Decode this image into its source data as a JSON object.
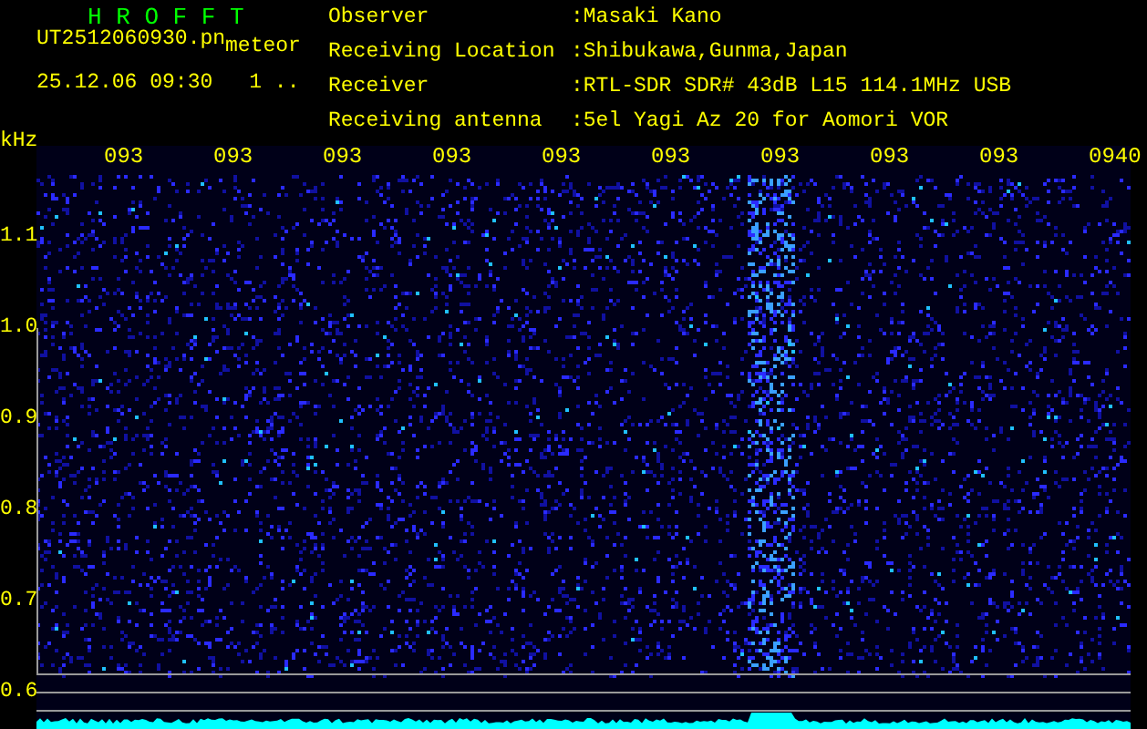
{
  "app_title": "H R O F F T",
  "file_name": "UT2512060930.pn",
  "mode": "meteor",
  "date_time": "25.12.06 09:30",
  "counter": "1 ..",
  "info": [
    {
      "label": "Observer",
      "value": ":Masaki Kano"
    },
    {
      "label": "Receiving Location",
      "value": ":Shibukawa,Gunma,Japan"
    },
    {
      "label": "Receiver",
      "value": ":RTL-SDR SDR# 43dB L15 114.1MHz USB"
    },
    {
      "label": "Receiving antenna",
      "value": ":5el Yagi Az 20 for Aomori VOR"
    }
  ],
  "y_unit": "kHz",
  "y_ticks": [
    "1.1",
    "1.0",
    "0.9",
    "0.8",
    "0.7",
    "0.6"
  ],
  "time_labels": [
    "093",
    "093",
    "093",
    "093",
    "093",
    "093",
    "093",
    "093",
    "093",
    "0940"
  ]
}
